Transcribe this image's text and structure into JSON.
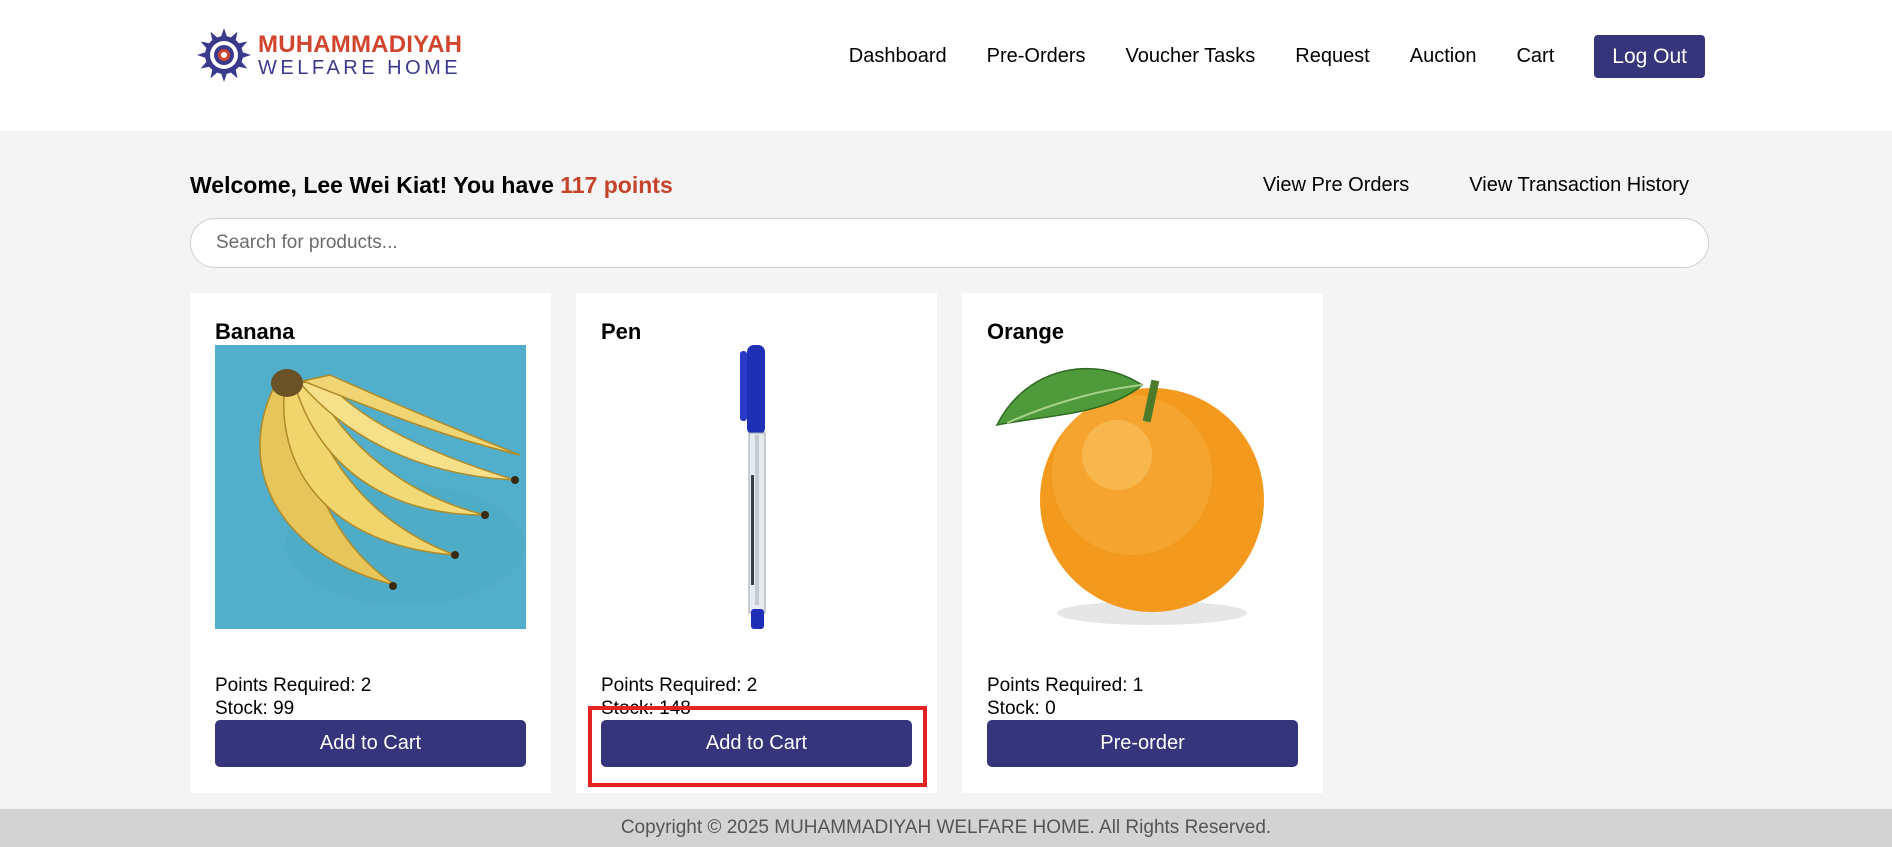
{
  "brand": {
    "line1": "MUHAMMADIYAH",
    "line2": "WELFARE HOME"
  },
  "nav": {
    "items": [
      {
        "label": "Dashboard"
      },
      {
        "label": "Pre-Orders"
      },
      {
        "label": "Voucher Tasks"
      },
      {
        "label": "Request"
      },
      {
        "label": "Auction"
      },
      {
        "label": "Cart"
      }
    ],
    "logout_label": "Log Out"
  },
  "welcome": {
    "prefix": "Welcome, Lee Wei Kiat! You have ",
    "points": "117 points"
  },
  "top_links": {
    "pre_orders": "View Pre Orders",
    "history": "View Transaction History"
  },
  "search": {
    "placeholder": "Search for products...",
    "value": ""
  },
  "products": [
    {
      "name": "Banana",
      "points": "Points Required: 2",
      "stock": "Stock: 99",
      "action": "Add to Cart",
      "image_icon": "banana-image"
    },
    {
      "name": "Pen",
      "points": "Points Required: 2",
      "stock": "Stock: 148",
      "action": "Add to Cart",
      "image_icon": "pen-image"
    },
    {
      "name": "Orange",
      "points": "Points Required: 1",
      "stock": "Stock: 0",
      "action": "Pre-order",
      "image_icon": "orange-image"
    }
  ],
  "footer": {
    "copyright": "Copyright © 2025 MUHAMMADIYAH WELFARE HOME. All Rights Reserved."
  },
  "colors": {
    "primary": "#34357a",
    "points_accent": "#c5432a",
    "highlight": "#e32222"
  }
}
